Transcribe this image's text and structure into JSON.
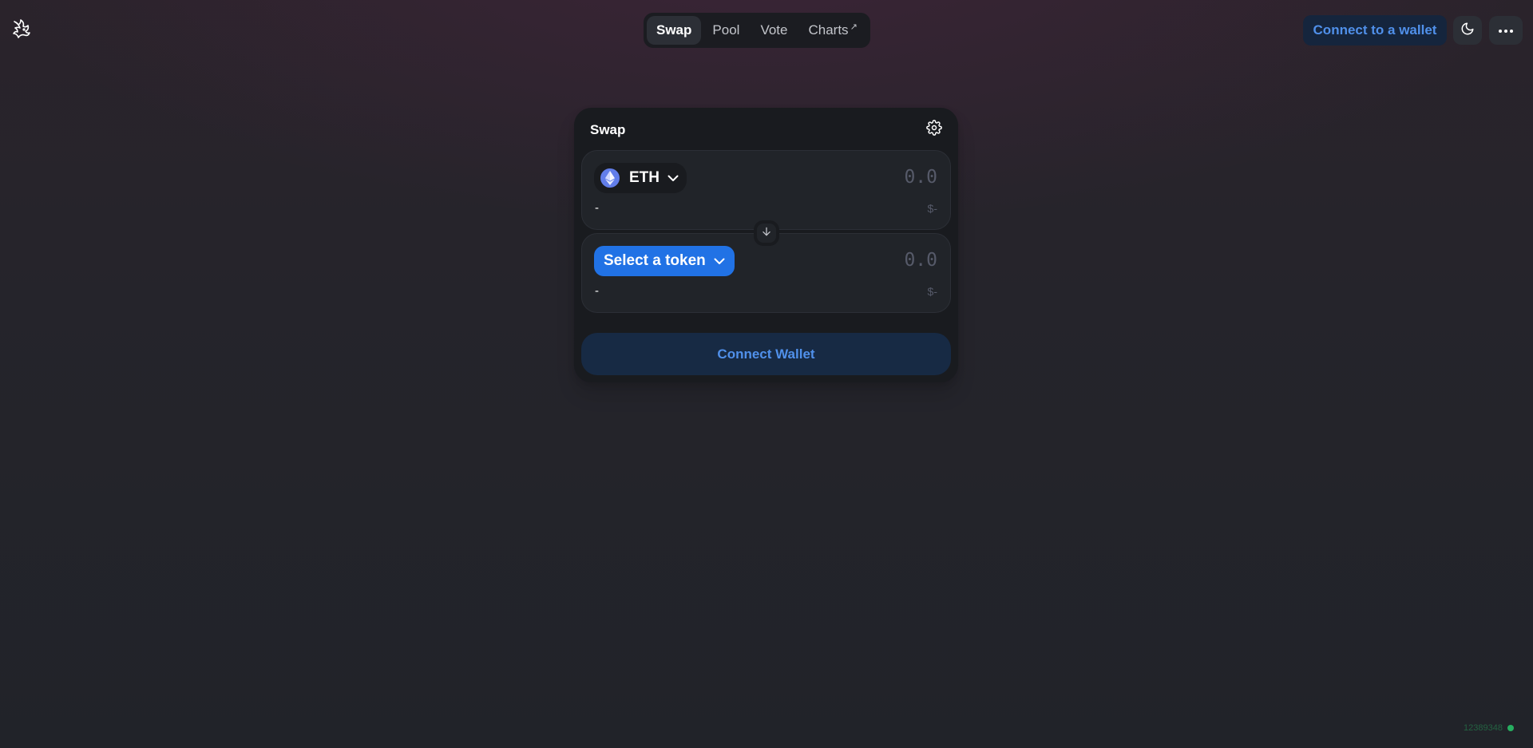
{
  "header": {
    "nav": [
      {
        "label": "Swap",
        "active": true
      },
      {
        "label": "Pool",
        "active": false
      },
      {
        "label": "Vote",
        "active": false
      },
      {
        "label": "Charts",
        "active": false,
        "external_icon": "↗"
      }
    ],
    "connect_label": "Connect to a wallet",
    "logo_icon": "unicorn-logo",
    "theme_icon": "moon-icon",
    "more_icon": "ellipsis-icon"
  },
  "swap": {
    "title": "Swap",
    "settings_icon": "gear-icon",
    "input": {
      "token": "ETH",
      "token_icon": "ethereum-icon",
      "placeholder": "0.0",
      "balance": "-",
      "usd": "$-"
    },
    "output": {
      "token_label": "Select a token",
      "placeholder": "0.0",
      "balance": "-",
      "usd": "$-"
    },
    "switch_icon": "arrow-down-icon",
    "wallet_button": "Connect Wallet"
  },
  "footer": {
    "block_number": "12389348",
    "status_color": "#27ae60"
  },
  "colors": {
    "accent": "#2172e5",
    "accent_text": "#5090ea",
    "card": "#191b1f",
    "panel": "#212429"
  }
}
